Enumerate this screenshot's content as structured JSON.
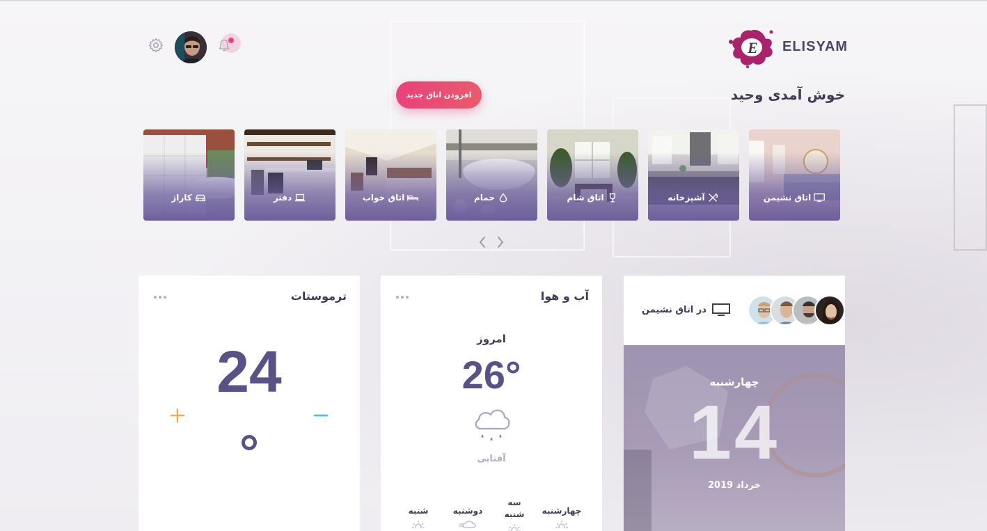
{
  "brand": {
    "name": "ELISYAM",
    "logo_letter": "E",
    "accent": "#a8236a"
  },
  "header": {
    "welcome": "خوش آمدی وحید",
    "add_room_label": "افزودن اتاق جدید",
    "icons": [
      "gear-icon",
      "avatar",
      "bell-icon"
    ]
  },
  "rooms": [
    {
      "label": "اتاق نشیمن",
      "icon": "tv-icon"
    },
    {
      "label": "آشپزخانه",
      "icon": "utensils-icon"
    },
    {
      "label": "اتاق شام",
      "icon": "wine-glass-icon"
    },
    {
      "label": "حمام",
      "icon": "drop-icon"
    },
    {
      "label": "اتاق خواب",
      "icon": "bed-icon"
    },
    {
      "label": "دفتر",
      "icon": "laptop-icon"
    },
    {
      "label": "کاراژ",
      "icon": "car-icon"
    }
  ],
  "thermostat": {
    "title": "ترموستات",
    "value": "24"
  },
  "weather": {
    "title": "آب و هوا",
    "today_label": "امروز",
    "temperature": "26°",
    "condition": "آفتابی",
    "forecast": [
      {
        "day": "چهارشنبه",
        "icon": "sun-icon"
      },
      {
        "day": "سه شنبه",
        "icon": "sun-icon"
      },
      {
        "day": "دوشنبه",
        "icon": "cloud-icon"
      },
      {
        "day": "شنبه",
        "icon": "sun-icon"
      }
    ]
  },
  "living_room": {
    "label": "در اتاق نشیمن",
    "weekday": "چهارشنبه",
    "day": "14",
    "month_year": "خرداد 2019"
  },
  "colors": {
    "primary": "#5b5186",
    "accent": "#e8427c",
    "plus": "#f6a94d",
    "minus": "#4cc3d8"
  }
}
